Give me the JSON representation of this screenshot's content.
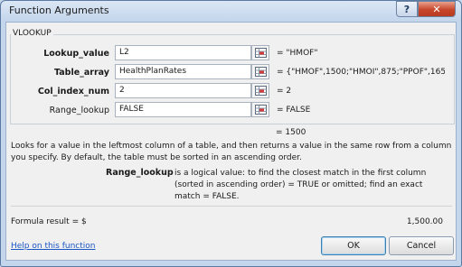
{
  "window": {
    "title": "Function Arguments",
    "help_glyph": "?",
    "close_glyph": "✕"
  },
  "function_name": "VLOOKUP",
  "arguments": [
    {
      "label": "Lookup_value",
      "value": "L2",
      "evaluated": "= \"HMOF\"",
      "bold": true
    },
    {
      "label": "Table_array",
      "value": "HealthPlanRates",
      "evaluated": "= {\"HMOF\",1500;\"HMOI\",875;\"PPOF\",165",
      "bold": true
    },
    {
      "label": "Col_index_num",
      "value": "2",
      "evaluated": "= 2",
      "bold": true
    },
    {
      "label": "Range_lookup",
      "value": "FALSE",
      "evaluated": "= FALSE",
      "bold": false
    }
  ],
  "result": "= 1500",
  "description": "Looks for a value in the leftmost column of a table, and then returns a value in the same row from a column you specify. By default, the table must be sorted in an ascending order.",
  "arg_help": {
    "name": "Range_lookup",
    "text": "is a logical value: to find the closest match in the first column (sorted in ascending order) = TRUE or omitted; find an exact match = FALSE."
  },
  "formula_result": {
    "label": "Formula result =   $",
    "value": "1,500.00"
  },
  "help_link": "Help on this function",
  "buttons": {
    "ok": "OK",
    "cancel": "Cancel"
  },
  "icons": {
    "ref_button": "range-select-icon"
  }
}
